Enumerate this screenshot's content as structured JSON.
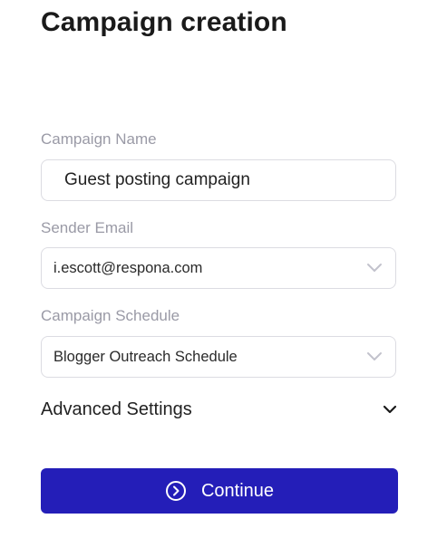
{
  "page": {
    "title": "Campaign creation"
  },
  "form": {
    "campaign_name": {
      "label": "Campaign Name",
      "value": "Guest posting campaign",
      "placeholder": ""
    },
    "sender_email": {
      "label": "Sender Email",
      "value": "i.escott@respona.com",
      "icon": "chevron-down-icon"
    },
    "campaign_schedule": {
      "label": "Campaign Schedule",
      "value": "Blogger Outreach Schedule",
      "icon": "chevron-down-icon"
    },
    "advanced_settings": {
      "label": "Advanced Settings",
      "icon": "chevron-down-icon"
    }
  },
  "actions": {
    "continue_label": "Continue",
    "continue_icon": "chevron-right-circle-icon"
  },
  "colors": {
    "primary": "#241eb8",
    "label": "#9a9aa6",
    "border": "#dcdce2",
    "chevron_muted": "#c2c2cc"
  }
}
